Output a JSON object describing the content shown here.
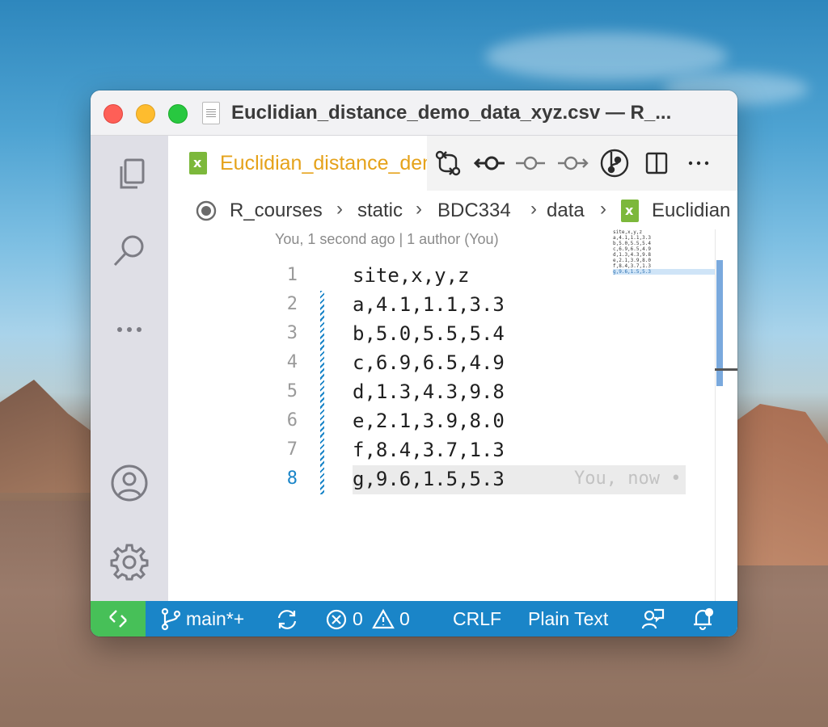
{
  "window": {
    "title": "Euclidian_distance_demo_data_xyz.csv — R_..."
  },
  "tab": {
    "label": "Euclidian_distance_demo_data_xyz.csv"
  },
  "breadcrumb": {
    "items": [
      "R_courses",
      "static",
      "BDC334",
      "data",
      "Euclidian"
    ]
  },
  "editor": {
    "blame_header": "You, 1 second ago | 1 author (You)",
    "lines": [
      {
        "number": "1",
        "text": "site,x,y,z"
      },
      {
        "number": "2",
        "text": "a,4.1,1.1,3.3"
      },
      {
        "number": "3",
        "text": "b,5.0,5.5,5.4"
      },
      {
        "number": "4",
        "text": "c,6.9,6.5,4.9"
      },
      {
        "number": "5",
        "text": "d,1.3,4.3,9.8"
      },
      {
        "number": "6",
        "text": "e,2.1,3.9,8.0"
      },
      {
        "number": "7",
        "text": "f,8.4,3.7,1.3"
      },
      {
        "number": "8",
        "text": "g,9.6,1.5,5.3"
      }
    ],
    "inline_blame": "You, now •",
    "active_line": "8"
  },
  "statusbar": {
    "branch": "main*+",
    "errors": "0",
    "warnings": "0",
    "eol": "CRLF",
    "language": "Plain Text"
  },
  "colors": {
    "statusbar_bg": "#1a85c8",
    "remote_bg": "#47c058",
    "tab_label": "#e5a21a",
    "csv_icon": "#7cb83b"
  },
  "icons": {
    "activitybar": [
      "explorer-icon",
      "search-icon",
      "more-icon",
      "account-icon",
      "settings-gear-icon"
    ],
    "toolbar": [
      "compare-changes-icon",
      "git-commit-previous-icon",
      "git-commit-icon",
      "git-commit-next-icon",
      "git-graph-icon",
      "split-editor-icon",
      "more-actions-icon"
    ],
    "statusbar": [
      "remote-icon",
      "source-control-branch-icon",
      "sync-icon",
      "error-icon",
      "warning-icon",
      "feedback-icon",
      "notifications-bell-icon"
    ]
  }
}
